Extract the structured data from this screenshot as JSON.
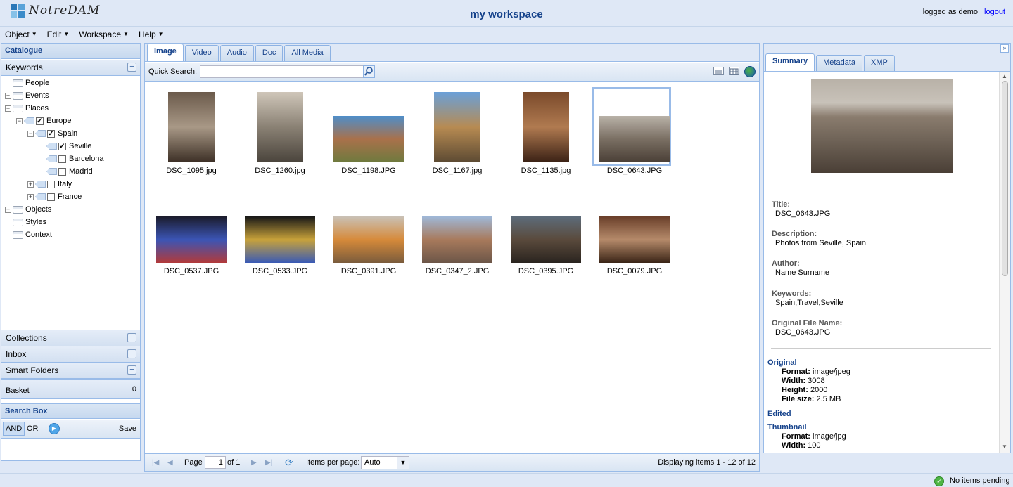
{
  "header": {
    "logo_text": "NotreDAM",
    "title": "my workspace",
    "logged_as": "logged as demo |",
    "logout": "logout"
  },
  "menubar": [
    "Object",
    "Edit",
    "Workspace",
    "Help"
  ],
  "catalogue": {
    "title": "Catalogue",
    "keywords_label": "Keywords",
    "tree": [
      {
        "label": "People",
        "level": 0,
        "expander": "",
        "kind": "folder",
        "checked": null
      },
      {
        "label": "Events",
        "level": 0,
        "expander": "+",
        "kind": "folder",
        "checked": null
      },
      {
        "label": "Places",
        "level": 0,
        "expander": "−",
        "kind": "folder",
        "checked": null
      },
      {
        "label": "Europe",
        "level": 1,
        "expander": "−",
        "kind": "tag",
        "checked": true
      },
      {
        "label": "Spain",
        "level": 2,
        "expander": "−",
        "kind": "tag",
        "checked": true
      },
      {
        "label": "Seville",
        "level": 3,
        "expander": "",
        "kind": "tag",
        "checked": true
      },
      {
        "label": "Barcelona",
        "level": 3,
        "expander": "",
        "kind": "tag",
        "checked": false
      },
      {
        "label": "Madrid",
        "level": 3,
        "expander": "",
        "kind": "tag",
        "checked": false
      },
      {
        "label": "Italy",
        "level": 2,
        "expander": "+",
        "kind": "tag",
        "checked": false
      },
      {
        "label": "France",
        "level": 2,
        "expander": "+",
        "kind": "tag",
        "checked": false
      },
      {
        "label": "Objects",
        "level": 0,
        "expander": "+",
        "kind": "folder",
        "checked": null
      },
      {
        "label": "Styles",
        "level": 0,
        "expander": "",
        "kind": "folder",
        "checked": null
      },
      {
        "label": "Context",
        "level": 0,
        "expander": "",
        "kind": "folder",
        "checked": null
      }
    ],
    "collections": "Collections",
    "inbox": "Inbox",
    "smart_folders": "Smart Folders",
    "basket": "Basket",
    "basket_count": "0",
    "search_box": "Search Box",
    "and": "AND",
    "or": "OR",
    "save": "Save"
  },
  "center": {
    "tabs": [
      "Image",
      "Video",
      "Audio",
      "Doc",
      "All Media"
    ],
    "quick_search_label": "Quick Search:",
    "items": [
      {
        "name": "DSC_1095.jpg",
        "colors": [
          "#6b5a4b",
          "#a89886",
          "#3c2f25"
        ]
      },
      {
        "name": "DSC_1260.jpg",
        "colors": [
          "#cfc6b9",
          "#8a8174",
          "#4a443c"
        ]
      },
      {
        "name": "DSC_1198.JPG",
        "colors": [
          "#4f8ec9",
          "#a9714b",
          "#6e7a3e"
        ]
      },
      {
        "name": "DSC_1167.jpg",
        "colors": [
          "#6aa0d8",
          "#b78b52",
          "#5c4a33"
        ]
      },
      {
        "name": "DSC_1135.jpg",
        "colors": [
          "#7a4a2b",
          "#b07a50",
          "#3a2115"
        ]
      },
      {
        "name": "DSC_0643.JPG",
        "colors": [
          "#b9b2a8",
          "#7a6f63",
          "#4a3f36"
        ]
      },
      {
        "name": "DSC_0537.JPG",
        "colors": [
          "#1b1b2b",
          "#3b55b5",
          "#b23a3a"
        ]
      },
      {
        "name": "DSC_0533.JPG",
        "colors": [
          "#171717",
          "#c8a23a",
          "#3a5ab5"
        ]
      },
      {
        "name": "DSC_0391.JPG",
        "colors": [
          "#c9c1b6",
          "#d68a3a",
          "#7a5c3c"
        ]
      },
      {
        "name": "DSC_0347_2.JPG",
        "colors": [
          "#9fb8d8",
          "#a87a5c",
          "#6c5648"
        ]
      },
      {
        "name": "DSC_0395.JPG",
        "colors": [
          "#5d6c7a",
          "#5a4a3c",
          "#2a241f"
        ]
      },
      {
        "name": "DSC_0079.JPG",
        "colors": [
          "#6a3f2a",
          "#b58a6a",
          "#3a2416"
        ]
      }
    ],
    "pager": {
      "page_label": "Page",
      "page_value": "1",
      "of_label": "of 1",
      "items_per_page_label": "Items per page:",
      "items_per_page_value": "Auto",
      "displaying": "Displaying items 1 - 12 of 12"
    }
  },
  "details": {
    "tabs": [
      "Summary",
      "Metadata",
      "XMP"
    ],
    "title_label": "Title:",
    "title_value": "DSC_0643.JPG",
    "description_label": "Description:",
    "description_value": "Photos from Seville, Spain",
    "author_label": "Author:",
    "author_value": "Name Surname",
    "keywords_label": "Keywords:",
    "keywords_value": "Spain,Travel,Seville",
    "orig_file_label": "Original File Name:",
    "orig_file_value": "DSC_0643.JPG",
    "original_section": "Original",
    "original": [
      {
        "k": "Format:",
        "v": "image/jpeg"
      },
      {
        "k": "Width:",
        "v": "3008"
      },
      {
        "k": "Height:",
        "v": "2000"
      },
      {
        "k": "File size:",
        "v": "2.5 MB"
      }
    ],
    "edited_section": "Edited",
    "thumbnail_section": "Thumbnail",
    "thumbnail": [
      {
        "k": "Format:",
        "v": "image/jpg"
      },
      {
        "k": "Width:",
        "v": "100"
      }
    ]
  },
  "status": {
    "text": "No items pending"
  },
  "colors": {
    "accent": "#15428b",
    "border": "#99bbe8",
    "logo": [
      "#2a78b8",
      "#59a3d9",
      "#86c1e8",
      "#3b8bc9"
    ]
  }
}
